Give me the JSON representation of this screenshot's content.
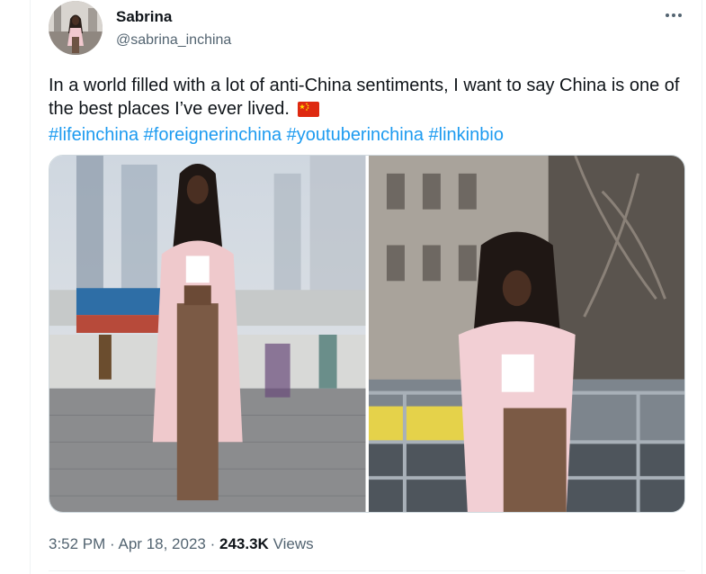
{
  "author": {
    "display_name": "Sabrina",
    "handle": "@sabrina_inchina"
  },
  "tweet": {
    "text": "In a world filled with a lot of anti-China sentiments, I want to say China is one of the best places I’ve ever lived.",
    "flag_icon": "china-flag-icon",
    "hashtags": [
      "#lifeinchina",
      "#foreignerinchina",
      "#youtuberinchina",
      "#linkinbio"
    ]
  },
  "meta": {
    "time": "3:52 PM",
    "separator": "·",
    "date": "Apr 18, 2023",
    "views_count": "243.3K",
    "views_label": "Views"
  },
  "icons": {
    "more": "more-options-icon"
  },
  "colors": {
    "link": "#1d9bf0",
    "secondary_text": "#536471",
    "primary_text": "#0f1419"
  }
}
